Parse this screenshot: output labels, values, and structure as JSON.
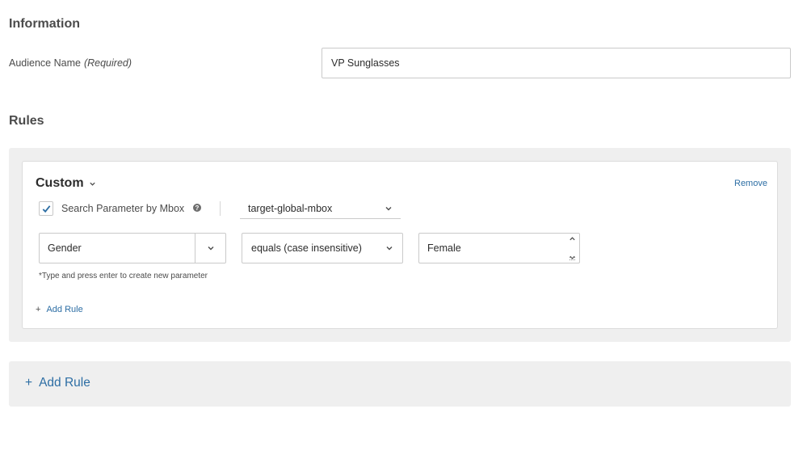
{
  "information": {
    "title": "Information",
    "audience_label": "Audience Name",
    "audience_required": "(Required)",
    "audience_value": "VP Sunglasses"
  },
  "rules": {
    "title": "Rules",
    "card": {
      "type_label": "Custom",
      "remove_label": "Remove",
      "mbox_checkbox_label": "Search Parameter by Mbox",
      "mbox_checked": true,
      "help_glyph": "?",
      "mbox_value": "target-global-mbox",
      "parameter_value": "Gender",
      "operator_value": "equals (case insensitive)",
      "condition_value": "Female",
      "hint": "*Type and press enter to create new parameter",
      "add_rule_plus": "+",
      "add_rule_label": "Add Rule"
    },
    "add_rule_plus": "+",
    "add_rule_label": "Add Rule"
  },
  "colors": {
    "link": "#2d6ea4",
    "checkbox_check": "#2d6ea4",
    "panel_bg": "#efefef"
  },
  "icons": [
    "chevron-down-icon",
    "checkmark-icon",
    "help-icon",
    "stepper-up-icon",
    "stepper-down-icon"
  ]
}
